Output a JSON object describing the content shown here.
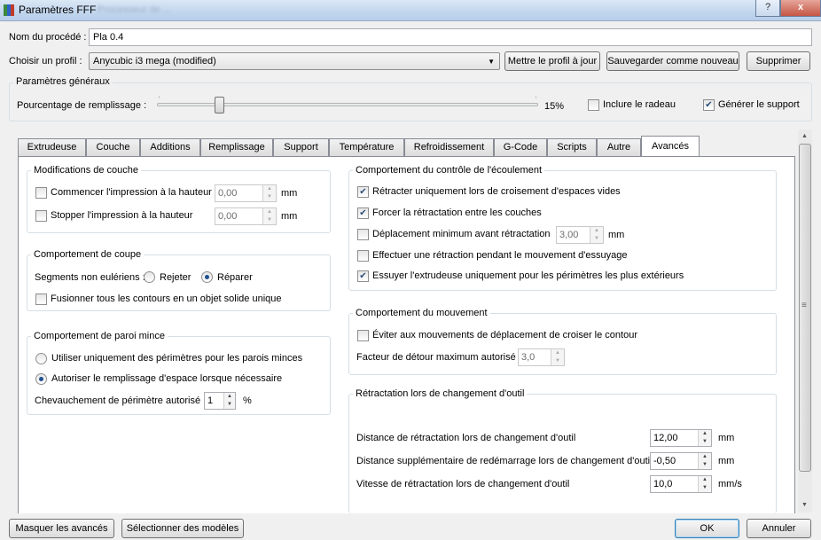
{
  "window": {
    "title": "Paramètres FFF",
    "title_blurred": "Processeur de ...",
    "help_glyph": "?",
    "close_glyph": "x"
  },
  "process": {
    "name_label": "Nom du procédé :",
    "name_value": "Pla 0.4",
    "profile_label": "Choisir un profil :",
    "profile_value": "Anycubic i3 mega (modified)",
    "update_button": "Mettre le profil à jour",
    "save_as_button": "Sauvegarder comme nouveau",
    "delete_button": "Supprimer"
  },
  "general": {
    "title": "Paramètres généraux",
    "infill_label": "Pourcentage de remplissage :",
    "infill_value": "15%",
    "infill_fraction": 0.15,
    "raft_label": "Inclure le radeau",
    "raft_checked": false,
    "support_label": "Générer le support",
    "support_checked": true
  },
  "tabs": [
    {
      "label": "Extrudeuse"
    },
    {
      "label": "Couche"
    },
    {
      "label": "Additions"
    },
    {
      "label": "Remplissage"
    },
    {
      "label": "Support"
    },
    {
      "label": "Température"
    },
    {
      "label": "Refroidissement"
    },
    {
      "label": "G-Code"
    },
    {
      "label": "Scripts"
    },
    {
      "label": "Autre"
    },
    {
      "label": "Avancés"
    }
  ],
  "active_tab": "Avancés",
  "layer_mods": {
    "title": "Modifications de couche",
    "start_label": "Commencer l'impression à la hauteur",
    "start_value": "0,00",
    "start_checked": false,
    "stop_label": "Stopper  l'impression à la hauteur",
    "stop_value": "0,00",
    "stop_checked": false,
    "unit": "mm"
  },
  "cut": {
    "title": "Comportement de coupe",
    "segments_label": "Segments non eulériens :",
    "reject_label": "Rejeter",
    "repair_label": "Réparer",
    "selected": "Réparer",
    "merge_label": "Fusionner tous les contours en un objet solide unique",
    "merge_checked": false
  },
  "thin_wall": {
    "title": "Comportement de paroi mince",
    "perimeters_only_label": "Utiliser uniquement des périmètres pour les parois minces",
    "gap_fill_label": "Autoriser le remplissage d'espace lorsque nécessaire",
    "selected": "Autoriser le remplissage d'espace lorsque nécessaire",
    "overlap_label": "Chevauchement de périmètre autorisé",
    "overlap_value": "1",
    "overlap_unit": "%"
  },
  "flow": {
    "title": "Comportement du contrôle de l'écoulement",
    "retract_open_label": "Rétracter uniquement lors de croisement d'espaces vides",
    "retract_open_checked": true,
    "force_retract_label": "Forcer la rétractation entre les couches",
    "force_retract_checked": true,
    "min_travel_label": "Déplacement minimum avant rétractation",
    "min_travel_value": "3,00",
    "min_travel_checked": false,
    "min_travel_unit": "mm",
    "wipe_label": "Effectuer une rétraction pendant le mouvement d'essuyage",
    "wipe_checked": false,
    "wipe_outer_label": "Essuyer l'extrudeuse uniquement pour les périmètres les plus extérieurs",
    "wipe_outer_checked": true
  },
  "movement": {
    "title": "Comportement du mouvement",
    "avoid_label": "Éviter aux mouvements de déplacement de croiser le contour",
    "avoid_checked": false,
    "detour_label": "Facteur de détour maximum autorisé",
    "detour_value": "3,0"
  },
  "tool_change": {
    "title": "Rétractation lors de changement d'outil",
    "distance_label": "Distance de rétractation lors de changement d'outil",
    "distance_value": "12,00",
    "distance_unit": "mm",
    "extra_label": "Distance supplémentaire de redémarrage lors de changement d'outil",
    "extra_value": "-0,50",
    "extra_unit": "mm",
    "speed_label": "Vitesse de rétractation lors de changement d'outil",
    "speed_value": "10,0",
    "speed_unit": "mm/s"
  },
  "footer": {
    "hide_advanced_button": "Masquer les avancés",
    "select_models_button": "Sélectionner des modèles",
    "ok_button": "OK",
    "cancel_button": "Annuler"
  },
  "scrollbar": {
    "up_glyph": "▲",
    "down_glyph": "▼",
    "grip_glyph": "≡"
  },
  "colors": {
    "title_bar": "#c3d7ee",
    "tab_active": "#ffffff",
    "window_bg": "#f0f0f0",
    "check_mark": "#2a4e7a"
  }
}
